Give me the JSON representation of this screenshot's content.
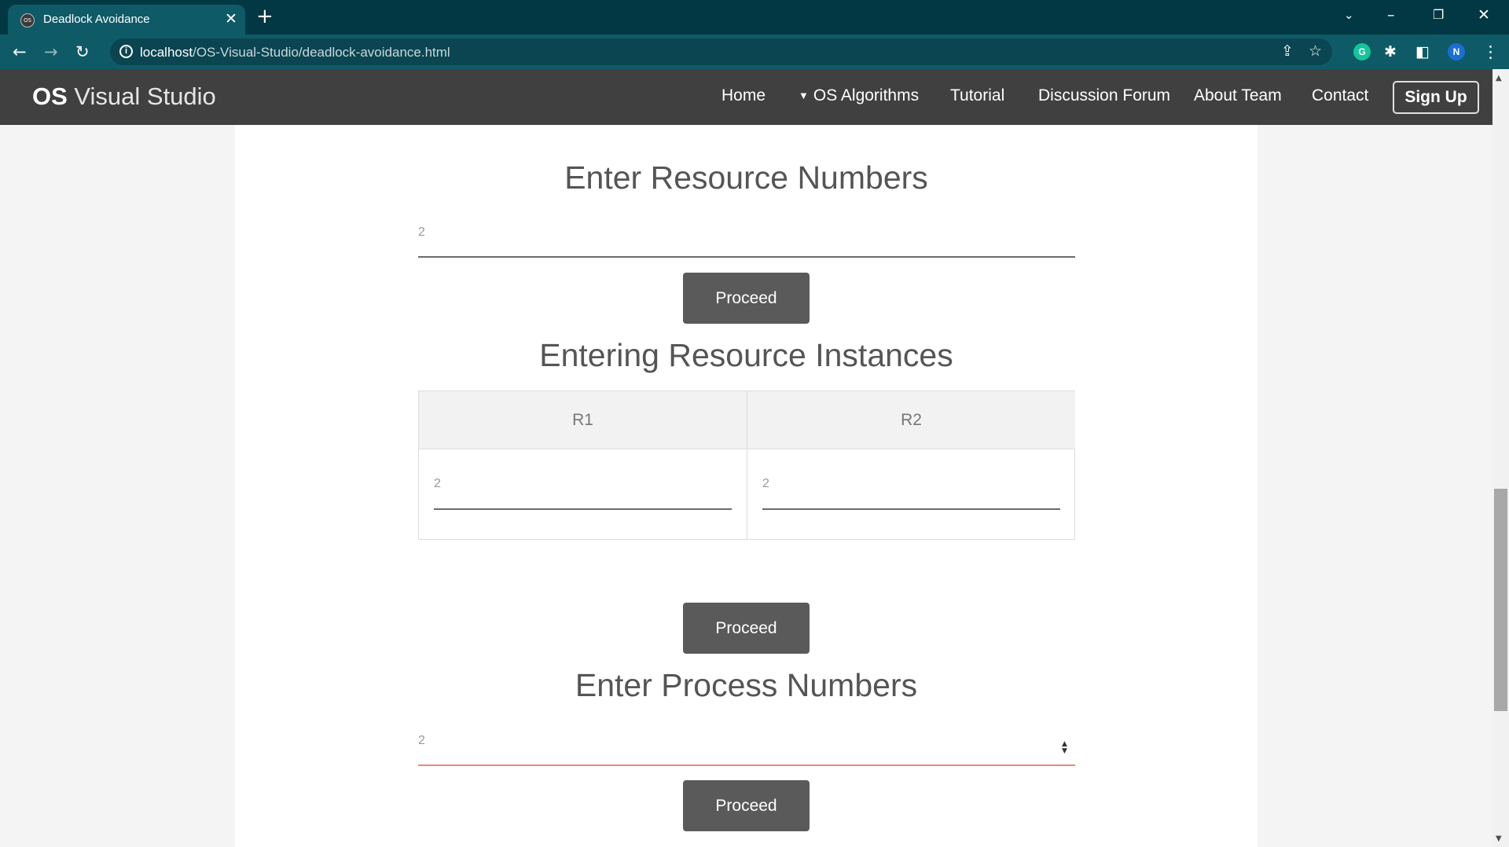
{
  "browser": {
    "tab_title": "Deadlock Avoidance",
    "favicon_text": "OS",
    "url_host": "localhost",
    "url_path": "/OS-Visual-Studio/deadlock-avoidance.html",
    "profile_initial": "N",
    "extension_initial": "G",
    "colors": {
      "tabstrip": "#023844",
      "toolbar": "#0f5a67"
    }
  },
  "navbar": {
    "brand_bold": "OS",
    "brand_rest": " Visual Studio",
    "links": [
      "Home",
      "OS Algorithms",
      "Tutorial",
      "Discussion Forum",
      "About Team",
      "Contact"
    ],
    "signup_label": "Sign Up"
  },
  "main": {
    "resource_heading": "Enter Resource Numbers",
    "resource_value": "2",
    "proceed_label": "Proceed",
    "instances_heading": "Entering Resource Instances",
    "instances_table": {
      "headers": [
        "R1",
        "R2"
      ],
      "values": [
        "2",
        "2"
      ]
    },
    "process_heading": "Enter Process Numbers",
    "process_value": "2"
  }
}
